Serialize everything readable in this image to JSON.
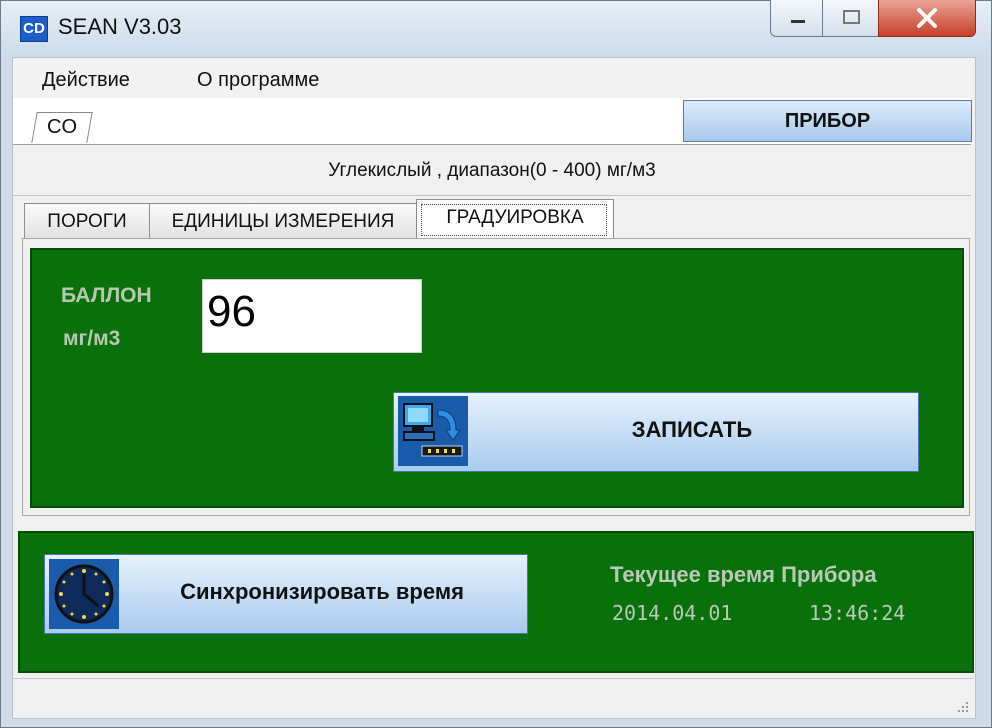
{
  "window": {
    "title": "SEAN V3.03",
    "icon_text": "CD"
  },
  "title_buttons": {
    "minimize": "minimize-icon",
    "maximize": "maximize-icon",
    "close": "close-icon"
  },
  "menu": {
    "items": [
      "Действие",
      "О программе"
    ]
  },
  "gas_tabs": [
    "CO"
  ],
  "device_button": "ПРИБОР",
  "gas_description": "Углекислый , диапазон(0 - 400) мг/м3",
  "sub_tabs": [
    "ПОРОГИ",
    "ЕДИНИЦЫ ИЗМЕРЕНИЯ",
    "ГРАДУИРОВКА"
  ],
  "active_sub_tab": "ГРАДУИРОВКА",
  "calibration": {
    "balloon_label": "БАЛЛОН",
    "unit_label": "мг/м3",
    "value": "96",
    "write_button": "ЗАПИСАТЬ"
  },
  "time_panel": {
    "sync_button": "Синхронизировать время",
    "title": "Текущее время Прибора",
    "date": "2014.04.01",
    "time": "13:46:24"
  },
  "colors": {
    "panel_green": "#09700c",
    "label_text": "#b7c8b0",
    "button_blue": "#a9cbee"
  }
}
